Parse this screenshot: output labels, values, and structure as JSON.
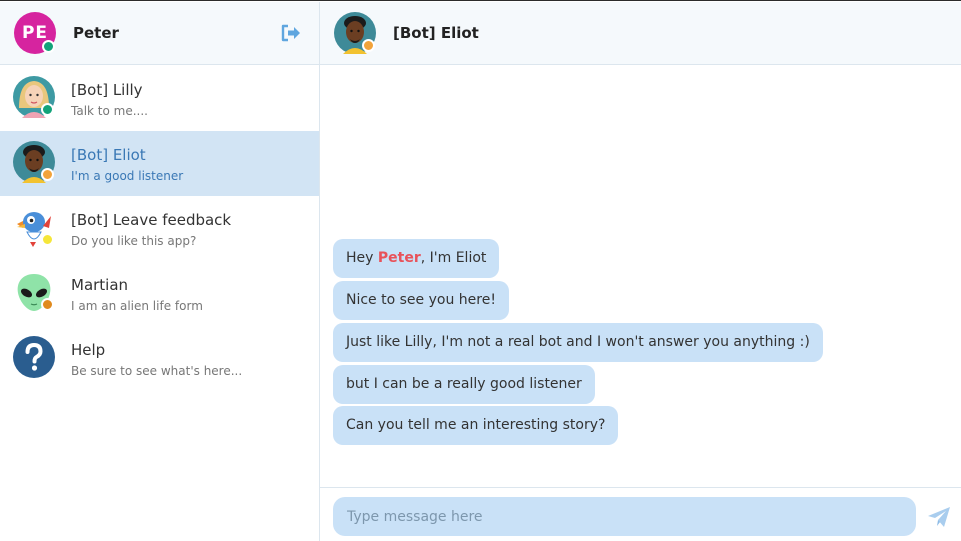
{
  "user": {
    "name": "Peter",
    "initials": "PE",
    "status": "online",
    "avatar_color": "#d6249f"
  },
  "contacts": [
    {
      "name": "[Bot] Lilly",
      "subtitle": "Talk to me....",
      "status": "online",
      "avatar": "woman-avatar-icon"
    },
    {
      "name": "[Bot] Eliot",
      "subtitle": "I'm a good listener",
      "status": "away",
      "avatar": "man-avatar-icon",
      "active": true
    },
    {
      "name": "[Bot] Leave feedback",
      "subtitle": "Do you like this app?",
      "status": "yellow",
      "avatar": "bird-avatar-icon"
    },
    {
      "name": "Martian",
      "subtitle": "I am an alien life form",
      "status": "orange",
      "avatar": "alien-avatar-icon"
    },
    {
      "name": "Help",
      "subtitle": "Be sure to see what's here...",
      "avatar": "help-icon"
    }
  ],
  "chat": {
    "title": "[Bot] Eliot",
    "messages": [
      {
        "before": "Hey ",
        "highlight": "Peter",
        "after": ", I'm Eliot"
      },
      {
        "text": "Nice to see you here!"
      },
      {
        "text": "Just like Lilly, I'm not a real bot and I won't answer you anything :)"
      },
      {
        "text": "but I can be a really good listener"
      },
      {
        "text": "Can you tell me an interesting story?"
      }
    ],
    "input_placeholder": "Type message here"
  },
  "colors": {
    "accent": "#3a78b5",
    "bubble": "#c9e1f7",
    "active_row": "#d2e4f4",
    "highlight": "#e8525a"
  }
}
